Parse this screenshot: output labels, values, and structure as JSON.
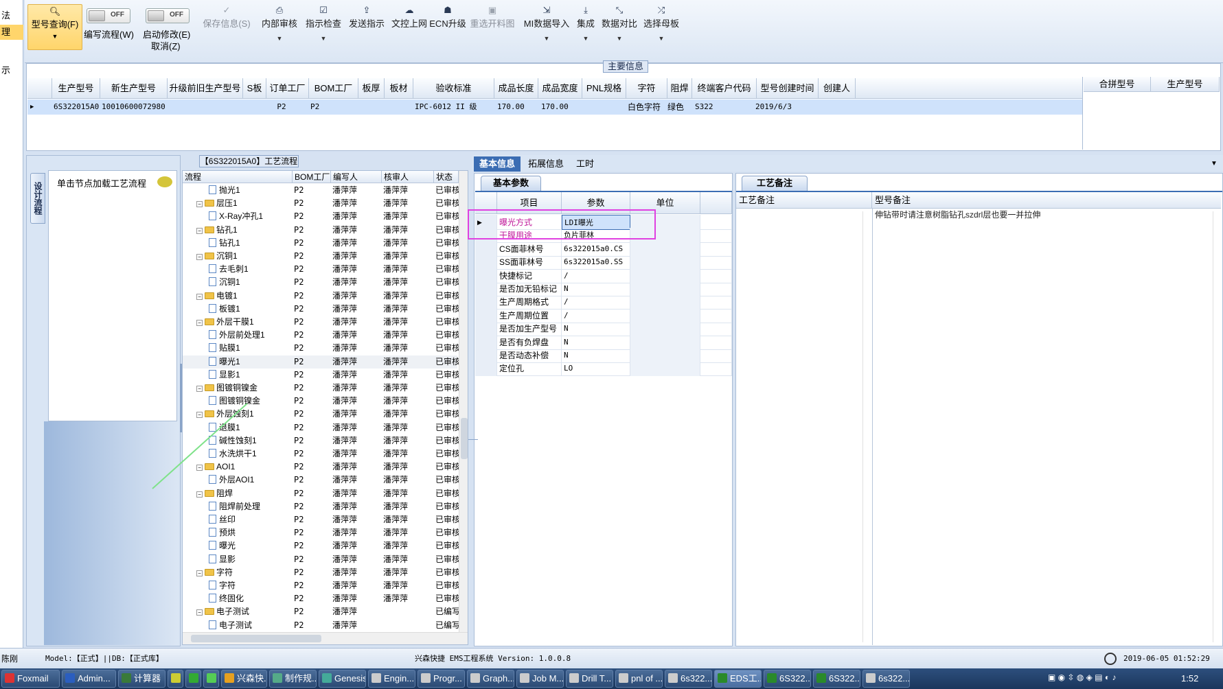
{
  "left_strip": {
    "items": [
      "法",
      "理",
      "示"
    ]
  },
  "toolbar": {
    "query_label": "型号查询(F)",
    "write_flow_label": "编写流程(W)",
    "write_flow_toggle": "OFF",
    "enable_edit_label": "启动修改(E)",
    "cancel_label": "取消(Z)",
    "enable_edit_toggle": "OFF",
    "buttons": [
      {
        "label": "保存信息(S)",
        "icon": "check-icon"
      },
      {
        "label": "内部审核",
        "icon": "printer-icon"
      },
      {
        "label": "指示检查",
        "icon": "checkbox-icon"
      },
      {
        "label": "发送指示",
        "icon": "upload-icon"
      },
      {
        "label": "文控上网",
        "icon": "cloud-icon"
      },
      {
        "label": "ECN升级",
        "icon": "people-icon"
      },
      {
        "label": "重选开料图",
        "icon": "image-icon"
      },
      {
        "label": "MI数据导入",
        "icon": "import-icon"
      },
      {
        "label": "集成",
        "icon": "download-icon"
      },
      {
        "label": "数据对比",
        "icon": "compare-icon"
      },
      {
        "label": "选择母板",
        "icon": "shuffle-icon"
      }
    ]
  },
  "main_info": {
    "title": "主要信息",
    "columns": [
      "生产型号",
      "新生产型号",
      "升级前旧生产型号",
      "S板",
      "订单工厂",
      "BOM工厂",
      "板厚",
      "板材",
      "验收标准",
      "成品长度",
      "成品宽度",
      "PNL规格",
      "字符",
      "阻焊",
      "终端客户代码",
      "型号创建时间",
      "创建人"
    ],
    "row": [
      "6S322015A0",
      "10010600072980",
      "",
      "",
      "P2",
      "P2",
      "",
      "",
      "IPC-6012 II 级",
      "170.00",
      "170.00",
      "",
      "白色字符",
      "绿色",
      "S322",
      "2019/6/3",
      ""
    ],
    "right_columns": [
      "合拼型号",
      "生产型号"
    ]
  },
  "left_panel": {
    "side_tab": "设计流程",
    "hint": "单击节点加载工艺流程"
  },
  "process_tree": {
    "title": "【6S322015A0】工艺流程",
    "columns": [
      "流程",
      "BOM工厂",
      "编写人",
      "核审人",
      "状态"
    ],
    "rows": [
      {
        "name": "抛光1",
        "level": 2,
        "type": "doc",
        "bom": "P2",
        "writer": "潘萍萍",
        "reviewer": "潘萍萍",
        "status": "已审核"
      },
      {
        "name": "层压1",
        "level": 1,
        "type": "folder",
        "bom": "P2",
        "writer": "潘萍萍",
        "reviewer": "潘萍萍",
        "status": "已审核"
      },
      {
        "name": "X-Ray冲孔1",
        "level": 2,
        "type": "doc",
        "bom": "P2",
        "writer": "潘萍萍",
        "reviewer": "潘萍萍",
        "status": "已审核"
      },
      {
        "name": "钻孔1",
        "level": 1,
        "type": "folder",
        "bom": "P2",
        "writer": "潘萍萍",
        "reviewer": "潘萍萍",
        "status": "已审核"
      },
      {
        "name": "钻孔1",
        "level": 2,
        "type": "doc",
        "bom": "P2",
        "writer": "潘萍萍",
        "reviewer": "潘萍萍",
        "status": "已审核"
      },
      {
        "name": "沉铜1",
        "level": 1,
        "type": "folder",
        "bom": "P2",
        "writer": "潘萍萍",
        "reviewer": "潘萍萍",
        "status": "已审核"
      },
      {
        "name": "去毛刺1",
        "level": 2,
        "type": "doc",
        "bom": "P2",
        "writer": "潘萍萍",
        "reviewer": "潘萍萍",
        "status": "已审核"
      },
      {
        "name": "沉铜1",
        "level": 2,
        "type": "doc",
        "bom": "P2",
        "writer": "潘萍萍",
        "reviewer": "潘萍萍",
        "status": "已审核"
      },
      {
        "name": "电镀1",
        "level": 1,
        "type": "folder",
        "bom": "P2",
        "writer": "潘萍萍",
        "reviewer": "潘萍萍",
        "status": "已审核"
      },
      {
        "name": "板镀1",
        "level": 2,
        "type": "doc",
        "bom": "P2",
        "writer": "潘萍萍",
        "reviewer": "潘萍萍",
        "status": "已审核"
      },
      {
        "name": "外层干膜1",
        "level": 1,
        "type": "folder",
        "bom": "P2",
        "writer": "潘萍萍",
        "reviewer": "潘萍萍",
        "status": "已审核"
      },
      {
        "name": "外层前处理1",
        "level": 2,
        "type": "doc",
        "bom": "P2",
        "writer": "潘萍萍",
        "reviewer": "潘萍萍",
        "status": "已审核"
      },
      {
        "name": "贴膜1",
        "level": 2,
        "type": "doc",
        "bom": "P2",
        "writer": "潘萍萍",
        "reviewer": "潘萍萍",
        "status": "已审核"
      },
      {
        "name": "曝光1",
        "level": 2,
        "type": "doc",
        "bom": "P2",
        "writer": "潘萍萍",
        "reviewer": "潘萍萍",
        "status": "已审核"
      },
      {
        "name": "显影1",
        "level": 2,
        "type": "doc",
        "bom": "P2",
        "writer": "潘萍萍",
        "reviewer": "潘萍萍",
        "status": "已审核"
      },
      {
        "name": "图镀铜镍金",
        "level": 1,
        "type": "folder",
        "bom": "P2",
        "writer": "潘萍萍",
        "reviewer": "潘萍萍",
        "status": "已审核"
      },
      {
        "name": "图镀铜镍金",
        "level": 2,
        "type": "doc",
        "bom": "P2",
        "writer": "潘萍萍",
        "reviewer": "潘萍萍",
        "status": "已审核"
      },
      {
        "name": "外层蚀刻1",
        "level": 1,
        "type": "folder",
        "bom": "P2",
        "writer": "潘萍萍",
        "reviewer": "潘萍萍",
        "status": "已审核"
      },
      {
        "name": "退膜1",
        "level": 2,
        "type": "doc",
        "bom": "P2",
        "writer": "潘萍萍",
        "reviewer": "潘萍萍",
        "status": "已审核"
      },
      {
        "name": "碱性蚀刻1",
        "level": 2,
        "type": "doc",
        "bom": "P2",
        "writer": "潘萍萍",
        "reviewer": "潘萍萍",
        "status": "已审核"
      },
      {
        "name": "水洗烘干1",
        "level": 2,
        "type": "doc",
        "bom": "P2",
        "writer": "潘萍萍",
        "reviewer": "潘萍萍",
        "status": "已审核"
      },
      {
        "name": "AOI1",
        "level": 1,
        "type": "folder",
        "bom": "P2",
        "writer": "潘萍萍",
        "reviewer": "潘萍萍",
        "status": "已审核"
      },
      {
        "name": "外层AOI1",
        "level": 2,
        "type": "doc",
        "bom": "P2",
        "writer": "潘萍萍",
        "reviewer": "潘萍萍",
        "status": "已审核"
      },
      {
        "name": "阻焊",
        "level": 1,
        "type": "folder",
        "bom": "P2",
        "writer": "潘萍萍",
        "reviewer": "潘萍萍",
        "status": "已审核"
      },
      {
        "name": "阻焊前处理",
        "level": 2,
        "type": "doc",
        "bom": "P2",
        "writer": "潘萍萍",
        "reviewer": "潘萍萍",
        "status": "已审核"
      },
      {
        "name": "丝印",
        "level": 2,
        "type": "doc",
        "bom": "P2",
        "writer": "潘萍萍",
        "reviewer": "潘萍萍",
        "status": "已审核"
      },
      {
        "name": "预烘",
        "level": 2,
        "type": "doc",
        "bom": "P2",
        "writer": "潘萍萍",
        "reviewer": "潘萍萍",
        "status": "已审核"
      },
      {
        "name": "曝光",
        "level": 2,
        "type": "doc",
        "bom": "P2",
        "writer": "潘萍萍",
        "reviewer": "潘萍萍",
        "status": "已审核"
      },
      {
        "name": "显影",
        "level": 2,
        "type": "doc",
        "bom": "P2",
        "writer": "潘萍萍",
        "reviewer": "潘萍萍",
        "status": "已审核"
      },
      {
        "name": "字符",
        "level": 1,
        "type": "folder",
        "bom": "P2",
        "writer": "潘萍萍",
        "reviewer": "潘萍萍",
        "status": "已审核"
      },
      {
        "name": "字符",
        "level": 2,
        "type": "doc",
        "bom": "P2",
        "writer": "潘萍萍",
        "reviewer": "潘萍萍",
        "status": "已审核"
      },
      {
        "name": "终固化",
        "level": 2,
        "type": "doc",
        "bom": "P2",
        "writer": "潘萍萍",
        "reviewer": "潘萍萍",
        "status": "已审核"
      },
      {
        "name": "电子测试",
        "level": 1,
        "type": "folder",
        "bom": "P2",
        "writer": "潘萍萍",
        "reviewer": "",
        "status": "已编写"
      },
      {
        "name": "电子测试",
        "level": 2,
        "type": "doc",
        "bom": "P2",
        "writer": "潘萍萍",
        "reviewer": "",
        "status": "已编写"
      }
    ]
  },
  "detail_tabs": [
    "基本信息",
    "拓展信息",
    "工时"
  ],
  "params": {
    "subtab": "基本参数",
    "columns": [
      "项目",
      "参数",
      "单位"
    ],
    "rows": [
      {
        "item": "曝光方式",
        "value": "LDI曝光",
        "unit": "",
        "highlight": true
      },
      {
        "item": "干膜用途",
        "value": "负片菲林",
        "unit": "",
        "highlight": true
      },
      {
        "item": "CS面菲林号",
        "value": "6s322015a0.CS",
        "unit": ""
      },
      {
        "item": "SS面菲林号",
        "value": "6s322015a0.SS",
        "unit": ""
      },
      {
        "item": "快捷标记",
        "value": "/",
        "unit": ""
      },
      {
        "item": "是否加无铅标记",
        "value": "N",
        "unit": ""
      },
      {
        "item": "生产周期格式",
        "value": "/",
        "unit": ""
      },
      {
        "item": "生产周期位置",
        "value": "/",
        "unit": ""
      },
      {
        "item": "是否加生产型号",
        "value": "N",
        "unit": ""
      },
      {
        "item": "是否有负焊盘",
        "value": "N",
        "unit": ""
      },
      {
        "item": "是否动态补偿",
        "value": "N",
        "unit": ""
      },
      {
        "item": "定位孔",
        "value": "LO",
        "unit": ""
      }
    ]
  },
  "remarks": {
    "subtab": "工艺备注",
    "col1": "工艺备注",
    "col2": "型号备注",
    "model_remark": "伸钻带时请注意树脂钻孔szdrl层也要一并拉伸"
  },
  "status_bar": {
    "left": "陈刚",
    "model": "Model:【正式】||DB:【正式库】",
    "center": "兴森快捷 EMS工程系统 Version: 1.0.0.8",
    "datetime": "2019-06-05 01:52:29"
  },
  "taskbar": {
    "items": [
      "Foxmail",
      "Admin...",
      "计算器",
      "",
      "",
      "",
      "兴森快...",
      "制作规...",
      "Genesis",
      "Engin...",
      "Progr...",
      "Graph...",
      "Job M...",
      "Drill T...",
      "pnl of ...",
      "6s322...",
      "EDS工...",
      "6S322...",
      "6S322...",
      "6s322..."
    ],
    "clock": "1:52"
  },
  "colors": {
    "accent": "#3b6db3",
    "highlight_box": "#e040e0",
    "selected_row": "#cfe2fb",
    "remark_text": "#c0189a"
  }
}
